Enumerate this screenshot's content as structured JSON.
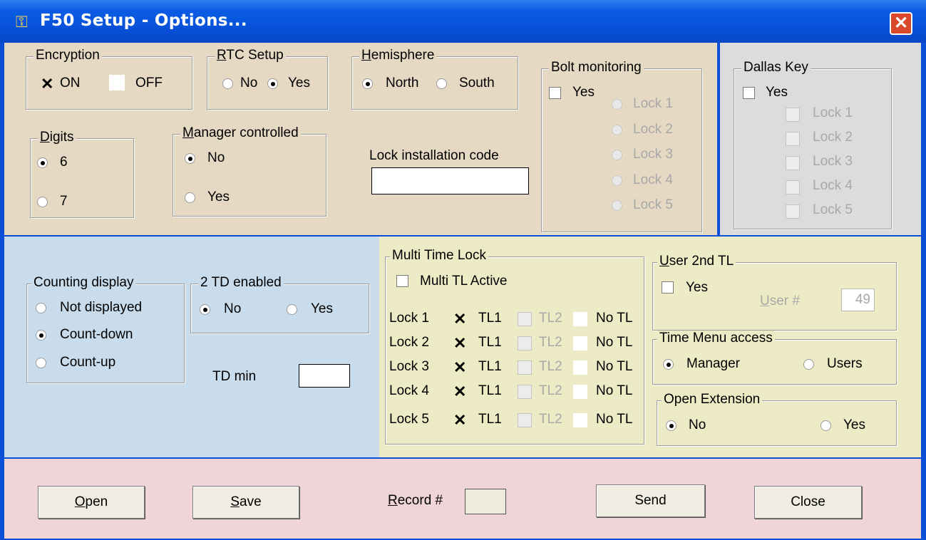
{
  "window": {
    "title": "F50 Setup - Options...",
    "colors": {
      "tan": "#e6d9c4",
      "gray": "#dcdcdc",
      "blue": "#c8dcec",
      "yellow": "#ecebc6",
      "pink": "#efd5d8",
      "titlebar": "#0a50d8"
    }
  },
  "encryption": {
    "label": "Encryption",
    "on_label": "ON",
    "off_label": "OFF",
    "on_checked": true,
    "off_checked": false
  },
  "rtc": {
    "label_prefix": "R",
    "label_rest": "TC Setup",
    "no": "No",
    "yes": "Yes",
    "selected": "Yes"
  },
  "hemisphere": {
    "label_prefix": "H",
    "label_rest": "emisphere",
    "north": "North",
    "south": "South",
    "selected": "North"
  },
  "bolt": {
    "label": "Bolt monitoring",
    "yes": "Yes",
    "locks": [
      "Lock 1",
      "Lock 2",
      "Lock 3",
      "Lock 4",
      "Lock 5"
    ]
  },
  "dallas": {
    "label": "Dallas Key",
    "yes": "Yes",
    "locks": [
      "Lock 1",
      "Lock 2",
      "Lock 3",
      "Lock 4",
      "Lock 5"
    ]
  },
  "digits": {
    "label_prefix": "D",
    "label_rest": "igits",
    "six": "6",
    "seven": "7",
    "selected": "6"
  },
  "manager": {
    "label_prefix": "M",
    "label_rest": "anager controlled",
    "no": "No",
    "yes": "Yes",
    "selected": "No"
  },
  "lock_install": {
    "label": "Lock installation code",
    "value": ""
  },
  "counting": {
    "label": "Counting display",
    "not_displayed": "Not displayed",
    "count_down": "Count-down",
    "count_up": "Count-up",
    "selected": "Count-down"
  },
  "td2": {
    "label": "2 TD enabled",
    "no": "No",
    "yes": "Yes",
    "selected": "No"
  },
  "tdmin": {
    "label": "TD min",
    "value": ""
  },
  "multi": {
    "label": "Multi Time Lock",
    "active_label": "Multi TL Active",
    "rows": [
      {
        "lock": "Lock 1",
        "tl1": "TL1",
        "tl2": "TL2",
        "notl": "No TL"
      },
      {
        "lock": "Lock 2",
        "tl1": "TL1",
        "tl2": "TL2",
        "notl": "No TL"
      },
      {
        "lock": "Lock 3",
        "tl1": "TL1",
        "tl2": "TL2",
        "notl": "No TL"
      },
      {
        "lock": "Lock 4",
        "tl1": "TL1",
        "tl2": "TL2",
        "notl": "No TL"
      },
      {
        "lock": "Lock 5",
        "tl1": "TL1",
        "tl2": "TL2",
        "notl": "No TL"
      }
    ]
  },
  "user2": {
    "label_prefix": "U",
    "label_rest": "ser 2nd TL",
    "yes": "Yes",
    "user_prefix": "U",
    "user_rest": "ser #",
    "user_value": "49"
  },
  "time_menu": {
    "label": "Time Menu access",
    "manager": "Manager",
    "users": "Users",
    "selected": "Manager"
  },
  "open_ext": {
    "label": "Open Extension",
    "no": "No",
    "yes": "Yes",
    "selected": "No"
  },
  "footer": {
    "open_prefix": "O",
    "open_rest": "pen",
    "save_prefix": "S",
    "save_rest": "ave",
    "record_prefix": "R",
    "record_rest": "ecord #",
    "record_value": "",
    "send": "Send",
    "close": "Close"
  }
}
